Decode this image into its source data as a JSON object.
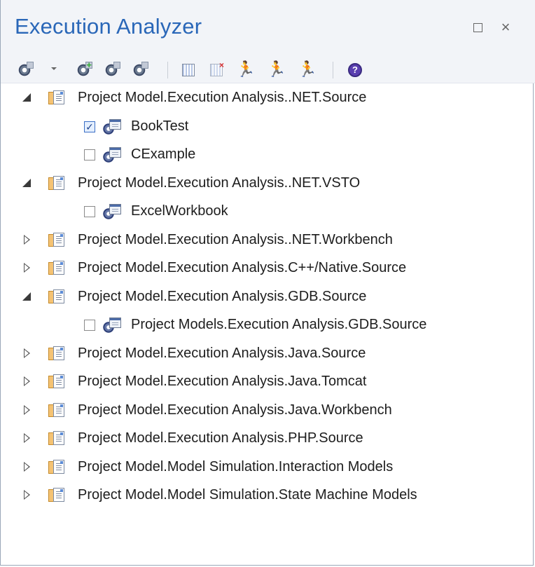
{
  "window": {
    "title": "Execution Analyzer",
    "restore_icon": "restore-icon",
    "close_glyph": "×"
  },
  "toolbar": {
    "buttons": [
      {
        "name": "configure-script-icon",
        "has_dropdown": true
      },
      {
        "name": "add-new-script-icon"
      },
      {
        "name": "copy-script-icon"
      },
      {
        "name": "paste-script-icon"
      },
      {
        "name": "build-icon"
      },
      {
        "name": "clean-icon"
      },
      {
        "name": "run-icon"
      },
      {
        "name": "debug-icon"
      },
      {
        "name": "run-tests-icon"
      },
      {
        "name": "help-icon"
      }
    ]
  },
  "tree": {
    "nodes": [
      {
        "label": "Project Model.Execution Analysis..NET.Source",
        "expanded": true,
        "level": 0
      },
      {
        "label": "BookTest",
        "checked": true,
        "level": 1
      },
      {
        "label": "CExample",
        "checked": false,
        "level": 1
      },
      {
        "label": "Project Model.Execution Analysis..NET.VSTO",
        "expanded": true,
        "level": 0
      },
      {
        "label": "ExcelWorkbook",
        "checked": false,
        "level": 1
      },
      {
        "label": "Project Model.Execution Analysis..NET.Workbench",
        "expanded": false,
        "level": 0
      },
      {
        "label": "Project Model.Execution Analysis.C++/Native.Source",
        "expanded": false,
        "level": 0
      },
      {
        "label": "Project Model.Execution Analysis.GDB.Source",
        "expanded": true,
        "level": 0
      },
      {
        "label": "Project Models.Execution Analysis.GDB.Source",
        "checked": false,
        "level": 1
      },
      {
        "label": "Project Model.Execution Analysis.Java.Source",
        "expanded": false,
        "level": 0
      },
      {
        "label": "Project Model.Execution Analysis.Java.Tomcat",
        "expanded": false,
        "level": 0
      },
      {
        "label": "Project Model.Execution Analysis.Java.Workbench",
        "expanded": false,
        "level": 0
      },
      {
        "label": "Project Model.Execution Analysis.PHP.Source",
        "expanded": false,
        "level": 0
      },
      {
        "label": "Project Model.Model Simulation.Interaction Models",
        "expanded": false,
        "level": 0
      },
      {
        "label": "Project Model.Model Simulation.State Machine Models",
        "expanded": false,
        "level": 0
      }
    ]
  },
  "colors": {
    "title": "#2a67b8",
    "header_bg": "#f2f4f8",
    "text": "#1d1d1d"
  }
}
